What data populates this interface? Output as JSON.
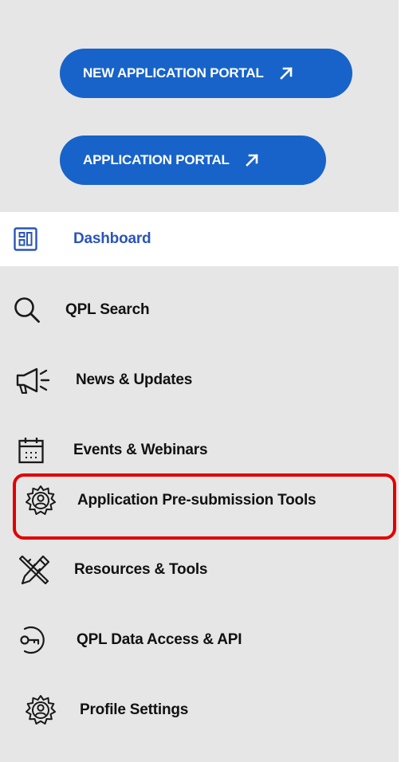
{
  "portal_buttons": {
    "new_application": "NEW APPLICATION PORTAL",
    "application": "APPLICATION PORTAL"
  },
  "nav": {
    "dashboard": "Dashboard",
    "qpl_search": "QPL Search",
    "news_updates": "News & Updates",
    "events_webinars": "Events & Webinars",
    "presubmission_tools": "Application Pre-submission Tools",
    "resources_tools": "Resources & Tools",
    "data_access_api": "QPL Data Access & API",
    "profile_settings": "Profile Settings"
  },
  "icons": {
    "external_link": "arrow-up-right-icon",
    "dashboard": "dashboard-grid-icon",
    "qpl_search": "search-icon",
    "news_updates": "megaphone-icon",
    "events_webinars": "calendar-icon",
    "presubmission_tools": "gear-user-icon",
    "resources_tools": "pencil-ruler-icon",
    "data_access_api": "key-icon",
    "profile_settings": "gear-user-icon"
  },
  "colors": {
    "sidebar_bg": "#e6e6e6",
    "button_bg": "#1763c9",
    "active_text": "#2a55b8",
    "highlight": "#e00000"
  }
}
